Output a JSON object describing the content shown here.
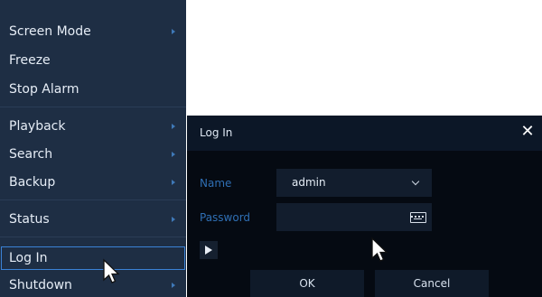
{
  "menu": {
    "items": [
      {
        "label": "Screen Mode",
        "submenu": true
      },
      {
        "label": "Freeze",
        "submenu": false
      },
      {
        "label": "Stop Alarm",
        "submenu": false
      },
      {
        "label": "Playback",
        "submenu": true
      },
      {
        "label": "Search",
        "submenu": true
      },
      {
        "label": "Backup",
        "submenu": true
      },
      {
        "label": "Status",
        "submenu": true
      },
      {
        "label": "Log In",
        "submenu": false,
        "selected": true
      },
      {
        "label": "Shutdown",
        "submenu": true
      }
    ]
  },
  "dialog": {
    "title": "Log In",
    "name_label": "Name",
    "name_value": "admin",
    "password_label": "Password",
    "password_value": "",
    "ok_label": "OK",
    "cancel_label": "Cancel"
  },
  "colors": {
    "menu_bg": "#1e2e44",
    "dialog_bg": "#050a12",
    "accent": "#3b82d6",
    "label_blue": "#2f6fb4"
  },
  "icons": {
    "submenu": "chevron-right-icon",
    "close": "close-icon",
    "dropdown": "chevron-down-icon",
    "keyboard": "keyboard-icon",
    "play": "play-icon",
    "cursor": "mouse-cursor-icon"
  }
}
